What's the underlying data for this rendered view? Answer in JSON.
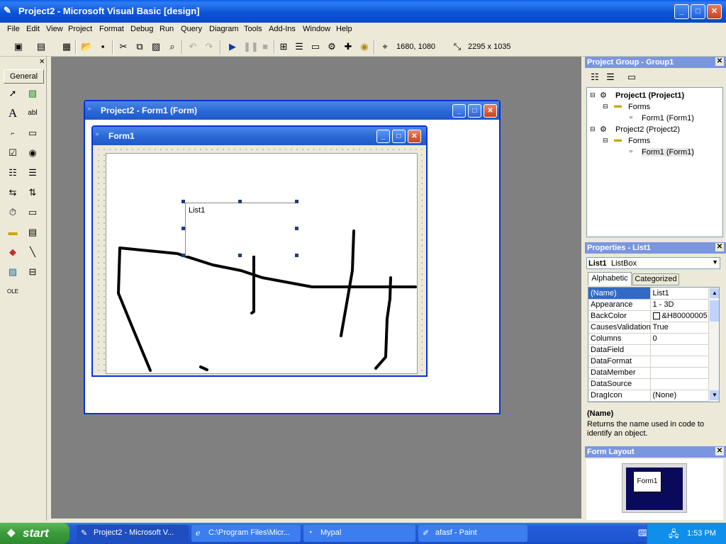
{
  "window": {
    "title": "Project2 - Microsoft Visual Basic [design]"
  },
  "menu": [
    "File",
    "Edit",
    "View",
    "Project",
    "Format",
    "Debug",
    "Run",
    "Query",
    "Diagram",
    "Tools",
    "Add-Ins",
    "Window",
    "Help"
  ],
  "toolbar": {
    "position": "1680, 1080",
    "size": "2295 x 1035"
  },
  "toolbox": {
    "tab": "General"
  },
  "form_designer": {
    "title": "Project2 - Form1 (Form)"
  },
  "form": {
    "title": "Form1",
    "listbox_label": "List1"
  },
  "project_group": {
    "title": "Project Group - Group1",
    "nodes": [
      {
        "label": "Project1 (Project1)",
        "bold": true
      },
      {
        "label": "Forms"
      },
      {
        "label": "Form1 (Form1)"
      },
      {
        "label": "Project2 (Project2)"
      },
      {
        "label": "Forms"
      },
      {
        "label": "Form1 (Form1)"
      }
    ]
  },
  "properties": {
    "title": "Properties - List1",
    "object_name": "List1",
    "object_type": "ListBox",
    "tabs": [
      "Alphabetic",
      "Categorized"
    ],
    "rows": [
      {
        "name": "(Name)",
        "value": "List1"
      },
      {
        "name": "Appearance",
        "value": "1 - 3D"
      },
      {
        "name": "BackColor",
        "value": "&H80000005"
      },
      {
        "name": "CausesValidation",
        "value": "True"
      },
      {
        "name": "Columns",
        "value": "0"
      },
      {
        "name": "DataField",
        "value": ""
      },
      {
        "name": "DataFormat",
        "value": ""
      },
      {
        "name": "DataMember",
        "value": ""
      },
      {
        "name": "DataSource",
        "value": ""
      },
      {
        "name": "DragIcon",
        "value": "(None)"
      }
    ],
    "desc_title": "(Name)",
    "desc_text": "Returns the name used in code to identify an object."
  },
  "form_layout": {
    "title": "Form Layout",
    "preview_label": "Form1"
  },
  "taskbar": {
    "start": "start",
    "tasks": [
      "Project2 - Microsoft V...",
      "C:\\Program Files\\Micr...",
      "Mypal",
      "afasf - Paint"
    ],
    "clock": "1:53 PM"
  }
}
